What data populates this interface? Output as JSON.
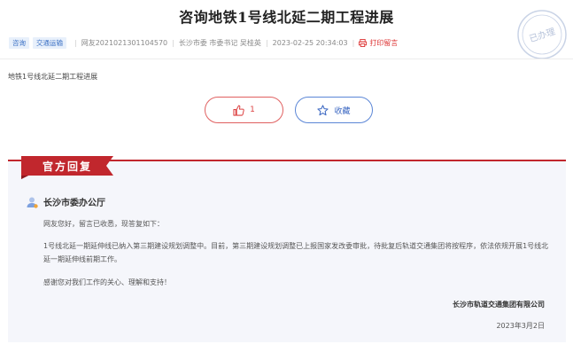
{
  "title": "咨询地铁1号线北延二期工程进展",
  "meta": {
    "tags": [
      "咨询",
      "交通运输"
    ],
    "netizen_id": "网友2021021301104570",
    "recipient": "长沙市委 市委书记 吴桂英",
    "timestamp": "2023-02-25 20:34:03",
    "print_label": "打印留言"
  },
  "stamp_text": "已办理",
  "content": "地铁1号线北延二期工程进展",
  "actions": {
    "like_count": "1",
    "favorite_label": "收藏"
  },
  "reply": {
    "ribbon_label": "官方回复",
    "department": "长沙市委办公厅",
    "greeting": "网友您好，留言已收悉，现答复如下：",
    "body": "1号线北延一期延伸线已纳入第三期建设规划调整中。目前，第三期建设规划调整已上报国家发改委审批，待批复后轨道交通集团将按程序，依法依规开展1号线北延一期延伸线前期工作。",
    "closing": "感谢您对我们工作的关心、理解和支持！",
    "organization": "长沙市轨道交通集团有限公司",
    "date": "2023年3月2日"
  },
  "colors": {
    "accent_red": "#c1272d",
    "accent_blue": "#3c68c2"
  },
  "icons": {
    "print": "printer-icon",
    "like": "thumbs-up-icon",
    "favorite": "star-icon",
    "department": "user-icon"
  }
}
